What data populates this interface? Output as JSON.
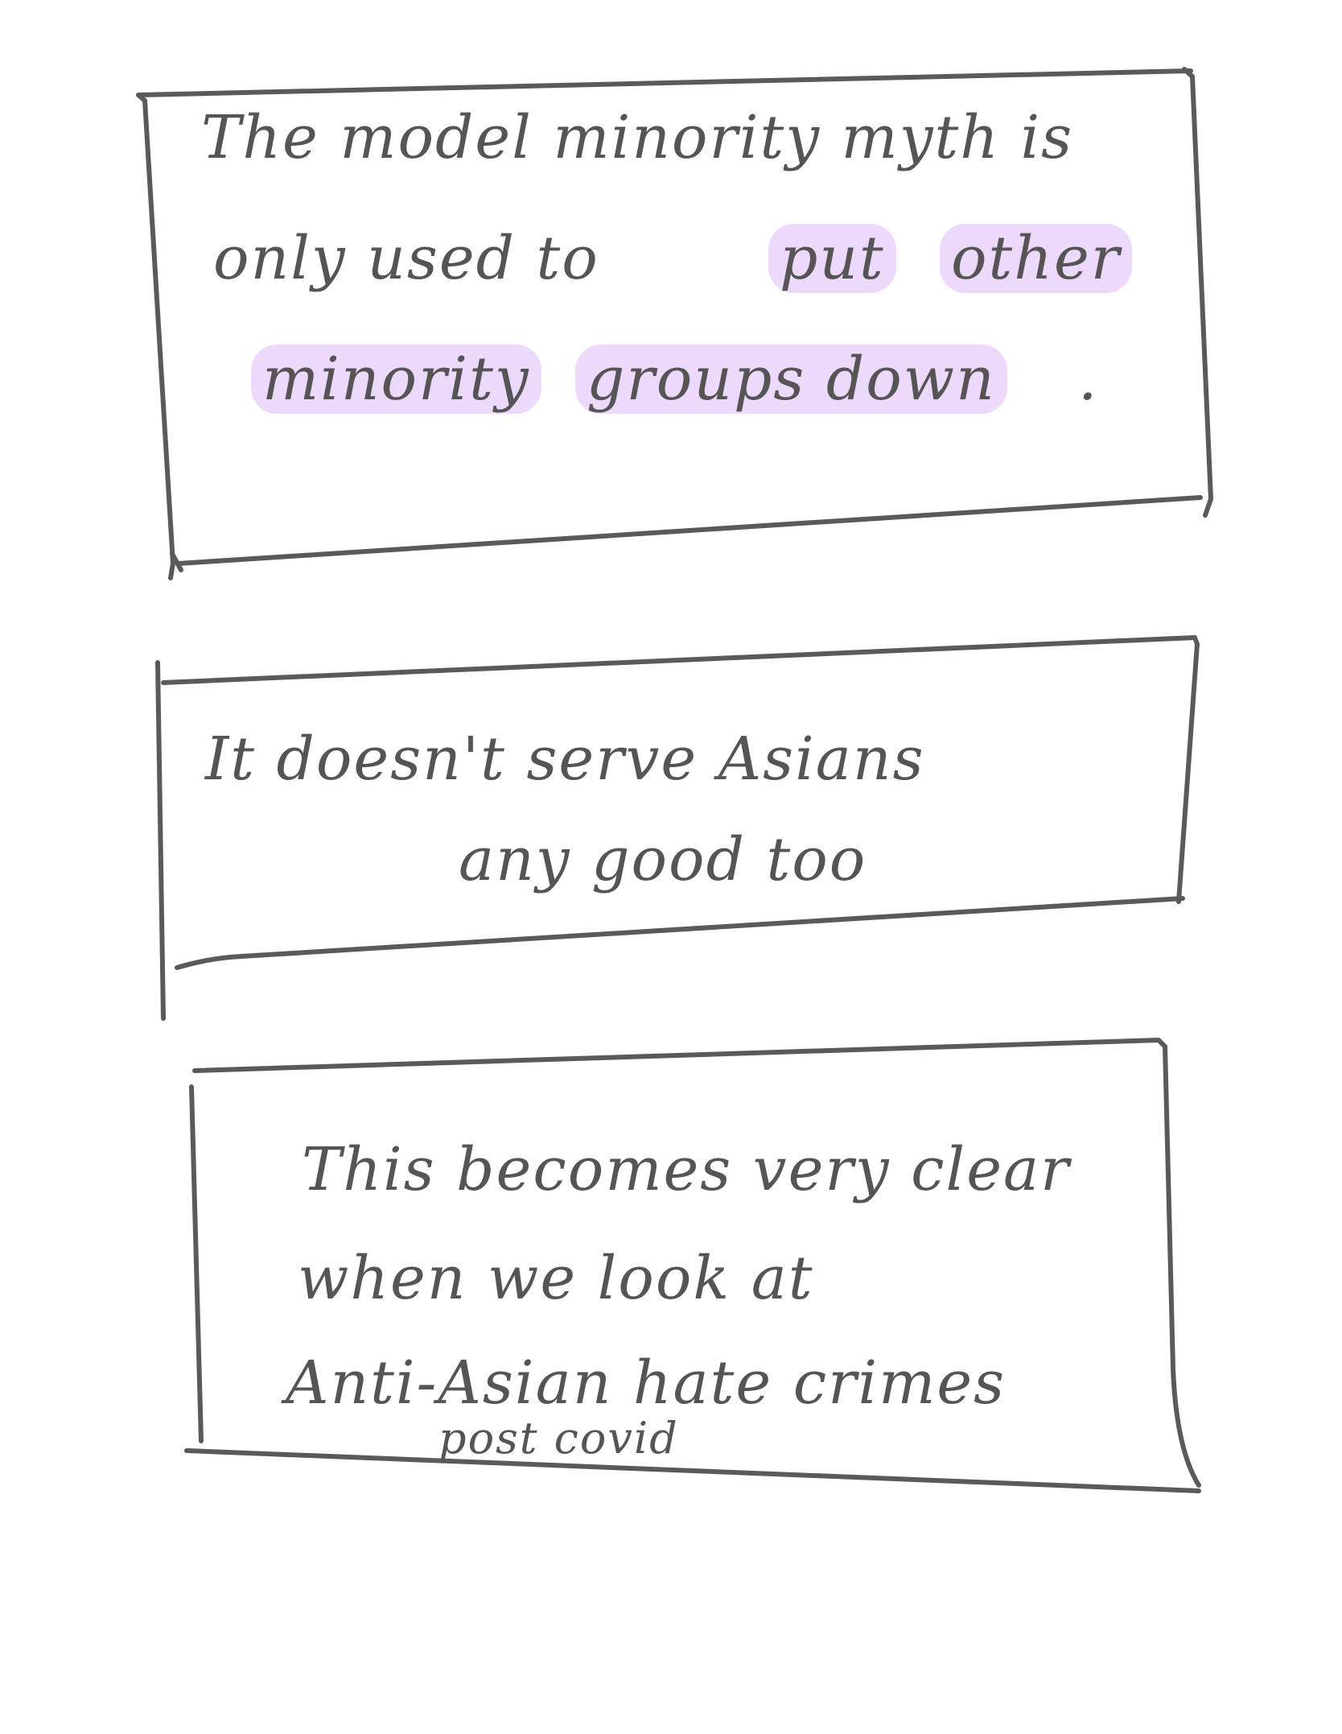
{
  "colors": {
    "ink": "#555555",
    "highlight": "#e4c8fb",
    "background": "#ffffff"
  },
  "notes": [
    {
      "lines": [
        "The model minority myth is",
        "only used to",
        "put",
        "other",
        "minority",
        "groups down",
        "."
      ]
    },
    {
      "lines": [
        "It doesn't serve Asians",
        "any good too"
      ]
    },
    {
      "lines": [
        "This becomes very clear",
        "when we look at",
        "Anti-Asian hate crimes",
        "post covid"
      ]
    }
  ]
}
